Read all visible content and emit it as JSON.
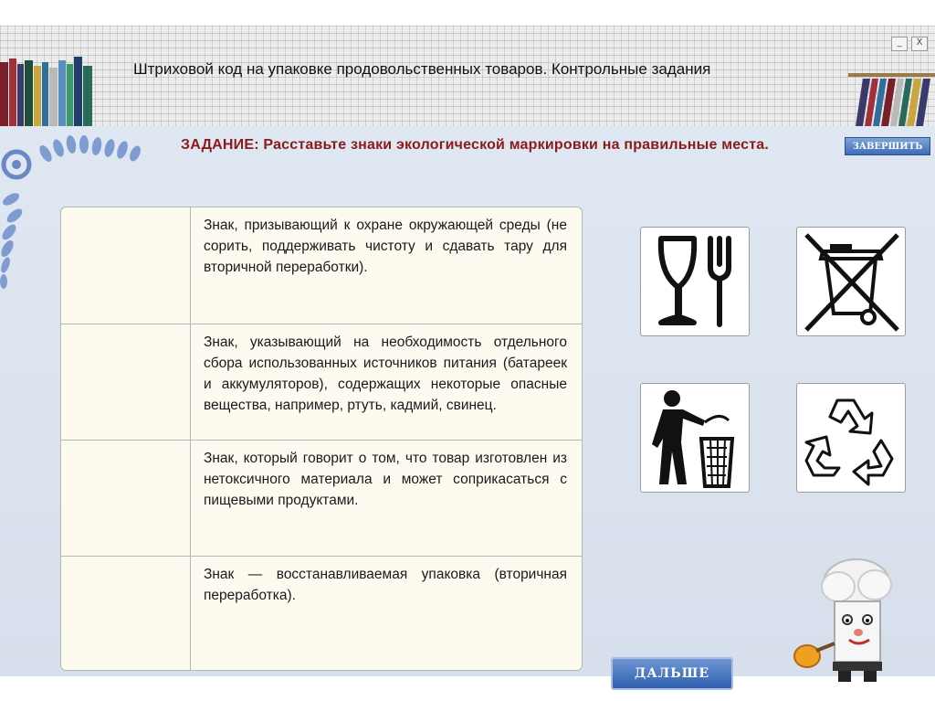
{
  "window": {
    "title": "Штриховой код на упаковке продовольственных товаров. Контрольные задания",
    "controls": [
      "_",
      "X"
    ]
  },
  "task": {
    "text": "ЗАДАНИЕ: Расставьте знаки экологической маркировки на правильные места."
  },
  "buttons": {
    "finish_label": "ЗАВЕРШИТЬ",
    "next_label": "ДАЛЬШЕ"
  },
  "table": {
    "rows": [
      {
        "text": "Знак, призывающий к охране окружающей среды (не сорить, поддерживать чистоту и сдавать тару для вторичной переработки)."
      },
      {
        "text": "Знак, указывающий на необходимость отдельного сбора использованных источников питания (батареек и аккумуляторов), содержащих некоторые опасные вещества, например, ртуть, кадмий, свинец."
      },
      {
        "text": "Знак, который говорит о том, что товар изготовлен из нетоксичного материала и может соприкасаться с пищевыми продуктами."
      },
      {
        "text": "Знак — восстанавливаемая упаковка (вторичная переработка)."
      }
    ]
  },
  "signs": [
    {
      "icon": "glass-fork-icon"
    },
    {
      "icon": "crossed-bin-icon"
    },
    {
      "icon": "tidyman-icon"
    },
    {
      "icon": "recycle-icon"
    }
  ],
  "colors": {
    "task_text": "#8b1a1a",
    "button_blue": "#3e6db6",
    "table_bg": "#fdfaf0",
    "background": "#dbe3ee"
  }
}
